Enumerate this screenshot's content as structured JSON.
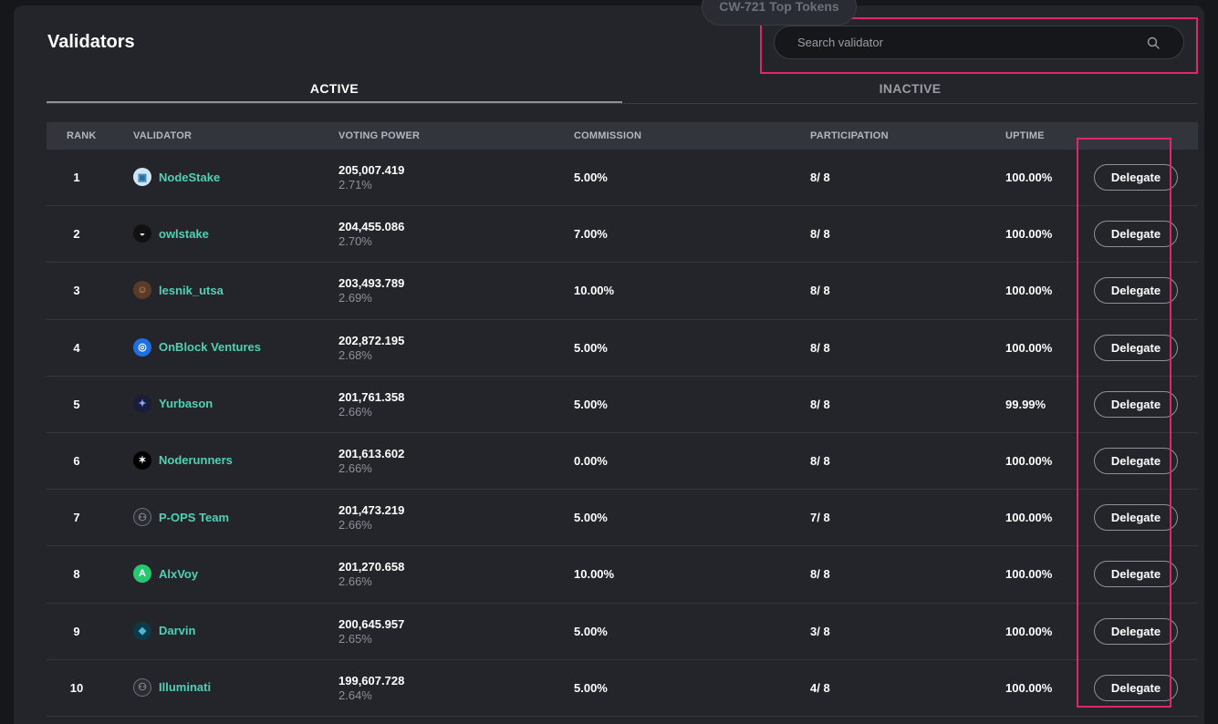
{
  "header": {
    "title": "Validators",
    "floating_chip": "CW-721 Top Tokens"
  },
  "search": {
    "placeholder": "Search validator",
    "value": "",
    "icon": "search-icon"
  },
  "tabs": [
    {
      "label": "ACTIVE",
      "active": true
    },
    {
      "label": "INACTIVE",
      "active": false
    }
  ],
  "table": {
    "columns": [
      "RANK",
      "VALIDATOR",
      "VOTING POWER",
      "COMMISSION",
      "PARTICIPATION",
      "UPTIME"
    ],
    "rows": [
      {
        "rank": "1",
        "name": "NodeStake",
        "voting_power": "205,007.419",
        "voting_pct": "2.71%",
        "commission": "5.00%",
        "participation": "8/ 8",
        "uptime": "100.00%",
        "delegate": "Delegate",
        "avatar": "nodestake-logo"
      },
      {
        "rank": "2",
        "name": "owlstake",
        "voting_power": "204,455.086",
        "voting_pct": "2.70%",
        "commission": "7.00%",
        "participation": "8/ 8",
        "uptime": "100.00%",
        "delegate": "Delegate",
        "avatar": "owl-logo"
      },
      {
        "rank": "3",
        "name": "lesnik_utsa",
        "voting_power": "203,493.789",
        "voting_pct": "2.69%",
        "commission": "10.00%",
        "participation": "8/ 8",
        "uptime": "100.00%",
        "delegate": "Delegate",
        "avatar": "character-avatar"
      },
      {
        "rank": "4",
        "name": "OnBlock Ventures",
        "voting_power": "202,872.195",
        "voting_pct": "2.68%",
        "commission": "5.00%",
        "participation": "8/ 8",
        "uptime": "100.00%",
        "delegate": "Delegate",
        "avatar": "onblock-logo"
      },
      {
        "rank": "5",
        "name": "Yurbason",
        "voting_power": "201,761.358",
        "voting_pct": "2.66%",
        "commission": "5.00%",
        "participation": "8/ 8",
        "uptime": "99.99%",
        "delegate": "Delegate",
        "avatar": "yurbason-logo"
      },
      {
        "rank": "6",
        "name": "Noderunners",
        "voting_power": "201,613.602",
        "voting_pct": "2.66%",
        "commission": "0.00%",
        "participation": "8/ 8",
        "uptime": "100.00%",
        "delegate": "Delegate",
        "avatar": "runner-logo"
      },
      {
        "rank": "7",
        "name": "P-OPS Team",
        "voting_power": "201,473.219",
        "voting_pct": "2.66%",
        "commission": "5.00%",
        "participation": "7/ 8",
        "uptime": "100.00%",
        "delegate": "Delegate",
        "avatar": "group-placeholder"
      },
      {
        "rank": "8",
        "name": "AlxVoy",
        "voting_power": "201,270.658",
        "voting_pct": "2.66%",
        "commission": "10.00%",
        "participation": "8/ 8",
        "uptime": "100.00%",
        "delegate": "Delegate",
        "avatar": "alxvoy-logo"
      },
      {
        "rank": "9",
        "name": "Darvin",
        "voting_power": "200,645.957",
        "voting_pct": "2.65%",
        "commission": "5.00%",
        "participation": "3/ 8",
        "uptime": "100.00%",
        "delegate": "Delegate",
        "avatar": "darvin-logo"
      },
      {
        "rank": "10",
        "name": "Illuminati",
        "voting_power": "199,607.728",
        "voting_pct": "2.64%",
        "commission": "5.00%",
        "participation": "4/ 8",
        "uptime": "100.00%",
        "delegate": "Delegate",
        "avatar": "group-placeholder"
      }
    ]
  },
  "colors": {
    "accent_name": "#4fd1b5",
    "highlight": "#e0266d",
    "card_bg": "#23252b",
    "page_bg": "#16171b"
  }
}
